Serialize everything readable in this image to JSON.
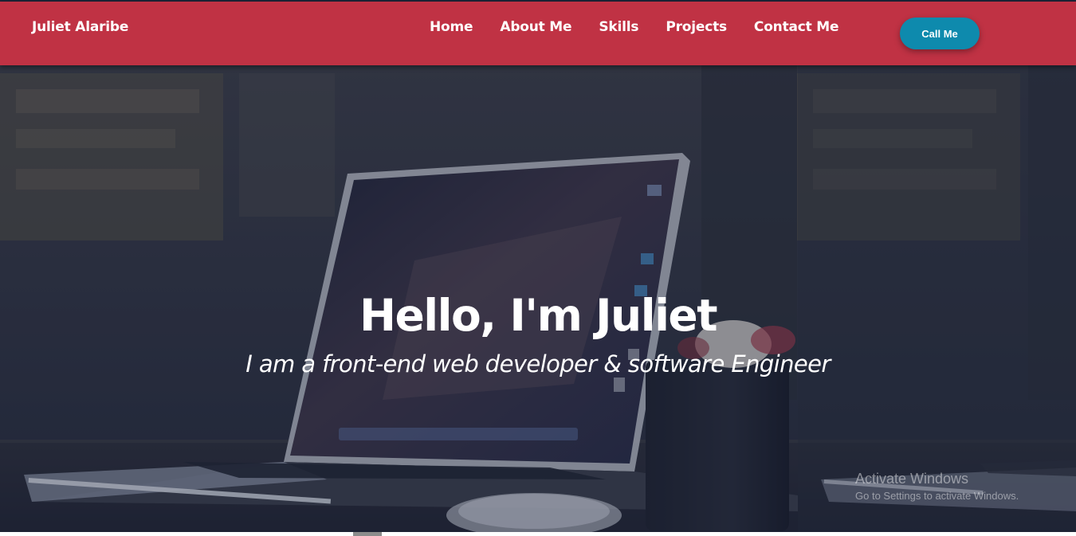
{
  "navbar": {
    "brand": "Juliet Alaribe",
    "links": [
      {
        "label": "Home"
      },
      {
        "label": "About Me"
      },
      {
        "label": "Skills"
      },
      {
        "label": "Projects"
      },
      {
        "label": "Contact Me"
      }
    ],
    "call_button": "Call Me"
  },
  "hero": {
    "title": "Hello, I'm Juliet",
    "subtitle": "I am a front-end web developer & software Engineer"
  },
  "os_overlay": {
    "activate_title": "Activate Windows",
    "activate_hint": "Go to Settings to activate Windows."
  },
  "colors": {
    "navbar": "#c03244",
    "call_button": "#0e8aad",
    "hero_overlay": "#1d2438"
  },
  "icons": {
    "hero_background": "laptop-desk-photo"
  }
}
